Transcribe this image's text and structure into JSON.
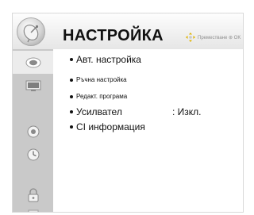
{
  "header": {
    "title": "НАСТРОЙКА",
    "nav_hint": "Преместване ⊛ OK",
    "icon": "satellite-dish-icon"
  },
  "sidebar": {
    "items": [
      {
        "icon": "satellite-dish-icon",
        "active": true
      },
      {
        "icon": "tv-screen-icon",
        "active": false
      },
      {
        "icon": "speaker-icon",
        "active": false
      },
      {
        "icon": "clock-icon",
        "active": false
      },
      {
        "icon": "lock-icon",
        "active": false
      },
      {
        "icon": "options-icon",
        "active": false
      }
    ]
  },
  "menu": {
    "items": [
      {
        "label": "Авт. настройка"
      },
      {
        "label": "Ръчна настройка"
      },
      {
        "label": "Редакт. програма"
      },
      {
        "label": "Усилвател",
        "value": ": Изкл."
      },
      {
        "label": "CI информация"
      }
    ]
  },
  "colors": {
    "sidebar_bg": "#c9c9c9",
    "sidebar_active_bg": "#ececec",
    "header_bg": "#eeeeee",
    "text": "#111111"
  }
}
